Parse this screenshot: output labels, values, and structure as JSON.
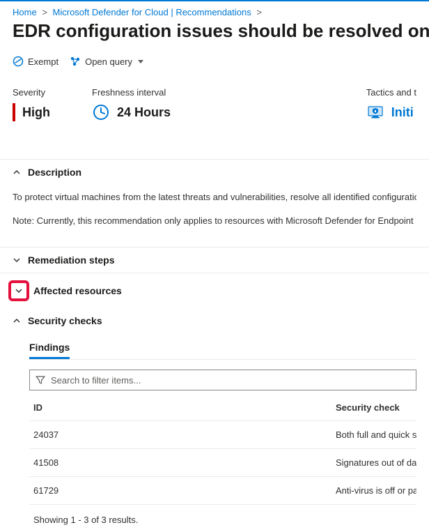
{
  "breadcrumb": {
    "home": "Home",
    "mid": "Microsoft Defender for Cloud | Recommendations",
    "sep": ">"
  },
  "page_title": "EDR configuration issues should be resolved on virtual m",
  "toolbar": {
    "exempt": "Exempt",
    "open_query": "Open query"
  },
  "metrics": {
    "severity_label": "Severity",
    "severity_value": "High",
    "freshness_label": "Freshness interval",
    "freshness_value": "24 Hours",
    "tactics_label": "Tactics and t",
    "tactics_value": "Initi"
  },
  "sections": {
    "description": "Description",
    "remediation": "Remediation steps",
    "affected": "Affected resources",
    "security": "Security checks"
  },
  "description": {
    "p1": "To protect virtual machines from the latest threats and vulnerabilities, resolve all identified configuration issue",
    "p2": "Note: Currently, this recommendation only applies to resources with Microsoft Defender for Endpoint (MDE) e"
  },
  "findings": {
    "tab_label": "Findings",
    "search_placeholder": "Search to filter items...",
    "columns": {
      "id": "ID",
      "check": "Security check"
    },
    "rows": [
      {
        "id": "24037",
        "check": "Both full and quick scans ar"
      },
      {
        "id": "41508",
        "check": "Signatures out of date"
      },
      {
        "id": "61729",
        "check": "Anti-virus is off or partially"
      }
    ],
    "count_text": "Showing 1 - 3 of 3 results."
  }
}
